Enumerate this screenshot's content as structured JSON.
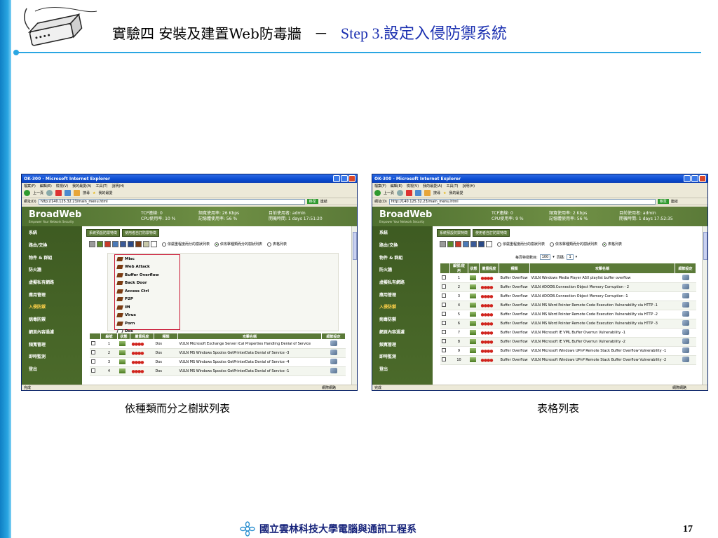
{
  "slide": {
    "title": "實驗四 安裝及建置Web防毒牆",
    "dash": "－",
    "step": "Step 3.設定入侵防禦系統",
    "caption_left": "依種類而分之樹狀列表",
    "caption_right": "表格列表",
    "footer": "國立雲林科技大學電腦與通訊工程系",
    "page_number": "17"
  },
  "browser": {
    "window_title": "OK-300 - Microsoft Internet Explorer",
    "menu": [
      "檔案(F)",
      "編輯(E)",
      "檢視(V)",
      "我的最愛(A)",
      "工具(T)",
      "說明(H)"
    ],
    "toolbar": {
      "back": "上一頁",
      "search": "搜尋",
      "favorites": "我的最愛"
    },
    "address_label": "網址(D)",
    "address": "http://140.125.32.23/main_menu.html",
    "go": "移至",
    "links": "連結",
    "status_left": "完成",
    "status_zone": "網際網路"
  },
  "app": {
    "brand": "BroadWeb",
    "tagline": "Empower Your Network Security",
    "sidebar": [
      "系統",
      "路由/交換",
      "物件 & 群組",
      "防火牆",
      "虛擬私有網路",
      "應用管理",
      "入侵防禦",
      "病毒防禦",
      "網頁內容過濾",
      "頻寬管理",
      "即時監測",
      "登出"
    ],
    "active_sidebar": "入侵防禦",
    "tabs": [
      "系統預設防禦特徵",
      "使用者自訂防禦特徵"
    ],
    "radio_options": [
      "依嚴重程度而分的樹狀列表",
      "依攻擊種類而分的樹狀列表",
      "表格列表"
    ]
  },
  "left_window": {
    "stats": {
      "tcp": "TCP連線: 0",
      "cpu": "CPU使用率: 10 %",
      "bandwidth": "頻寬使用率: 26 Kbps",
      "memory": "記憶體使用率: 56 %",
      "user": "目前使用者: admin",
      "uptime": "開機時間: 1 days 17:51:20"
    },
    "selected_radio": 1,
    "tree_nodes": [
      "Misc",
      "Web Attack",
      "Buffer Overflow",
      "Back Door",
      "Access Ctrl",
      "P2P",
      "IM",
      "Virus",
      "Porn",
      "Dos"
    ],
    "table_headers": [
      "編號",
      "狀態",
      "嚴重程度",
      "種類",
      "攻擊名稱",
      "細節設定"
    ],
    "rows": [
      {
        "id": "1",
        "severity": "●●●●",
        "type": "Dos",
        "name": "VULN Microsoft Exchange Server iCal Properties Handling Denial of Service"
      },
      {
        "id": "2",
        "severity": "●●●●",
        "type": "Dos",
        "name": "VULN MS Windows Spoolss GetPrinterData Denial of Service -3"
      },
      {
        "id": "3",
        "severity": "●●●●",
        "type": "Dos",
        "name": "VULN MS Windows Spoolss GetPrinterData Denial of Service -4"
      },
      {
        "id": "4",
        "severity": "●●●●",
        "type": "Dos",
        "name": "VULN MS Windows Spoolss GetPrinterData Denial of Service -1"
      }
    ]
  },
  "right_window": {
    "stats": {
      "tcp": "TCP連線: 0",
      "cpu": "CPU使用率: 9 %",
      "bandwidth": "頻寬使用率: 2 Kbps",
      "memory": "記憶體使用率: 56 %",
      "user": "目前使用者: admin",
      "uptime": "開機時間: 1 days 17:52:35"
    },
    "selected_radio": 2,
    "pager": {
      "label": "每頁特徵數目:",
      "per_page": "100",
      "page_label": "頁碼:",
      "page": "1"
    },
    "table_headers": [
      "編號/啟用",
      "狀態",
      "嚴重程度",
      "種類",
      "攻擊名稱",
      "細節設定"
    ],
    "rows": [
      {
        "id": "1",
        "severity": "●●●●",
        "type": "Buffer Overflow",
        "name": "VULN Windows Media Player ASX playlist buffer overflow"
      },
      {
        "id": "2",
        "severity": "●●●●",
        "type": "Buffer Overflow",
        "name": "VULN ADODB.Connection Object Memory Corruption - 2"
      },
      {
        "id": "3",
        "severity": "●●●●",
        "type": "Buffer Overflow",
        "name": "VULN ADODB.Connection Object Memory Corruption -1"
      },
      {
        "id": "4",
        "severity": "●●●●",
        "type": "Buffer Overflow",
        "name": "VULN MS Word Pointer Remote Code Execution Vulnerability via HTTP -1"
      },
      {
        "id": "5",
        "severity": "●●●●",
        "type": "Buffer Overflow",
        "name": "VULN MS Word Pointer Remote Code Execution Vulnerability via HTTP -2"
      },
      {
        "id": "6",
        "severity": "●●●●",
        "type": "Buffer Overflow",
        "name": "VULN MS Word Pointer Remote Code Execution Vulnerability via HTTP -3"
      },
      {
        "id": "7",
        "severity": "●●●●",
        "type": "Buffer Overflow",
        "name": "VULN Microsoft IE VML Buffer Overrun Vulnerability -1"
      },
      {
        "id": "8",
        "severity": "●●●●",
        "type": "Buffer Overflow",
        "name": "VULN Microsoft IE VML Buffer Overrun Vulnerability -2"
      },
      {
        "id": "9",
        "severity": "●●●●",
        "type": "Buffer Overflow",
        "name": "VULN Microsoft Windows UPnP Remote Stack Buffer Overflow Vulnerability -1"
      },
      {
        "id": "10",
        "severity": "●●●●",
        "type": "Buffer Overflow",
        "name": "VULN Microsoft Windows UPnP Remote Stack Buffer Overflow Vulnerability -2"
      }
    ]
  }
}
